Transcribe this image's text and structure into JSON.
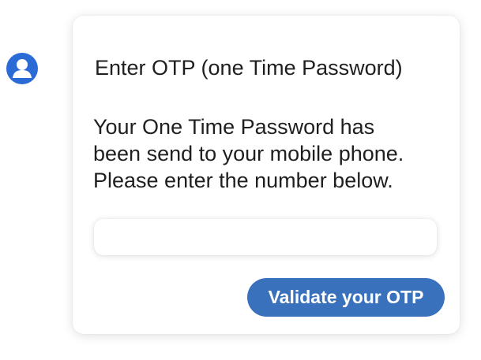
{
  "sender": {
    "avatar_icon": "user-avatar-icon",
    "avatar_color": "#2a6bd6"
  },
  "otp_card": {
    "title": "Enter OTP (one Time Password)",
    "message_lines": [
      "Your One Time Password has",
      "been send to your mobile phone.",
      "Please enter the number below."
    ],
    "input": {
      "value": "",
      "placeholder": ""
    },
    "validate_button_label": "Validate your OTP",
    "button_color": "#3a71bc"
  }
}
